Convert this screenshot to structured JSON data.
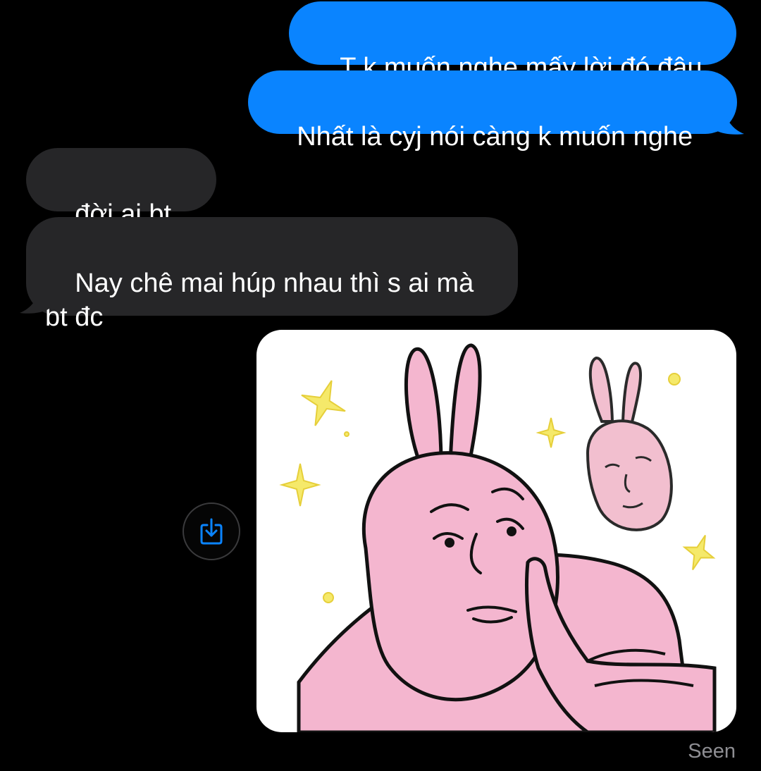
{
  "conversation": {
    "messages": [
      {
        "direction": "sent",
        "text": "T k muốn nghe mấy lời đó đâu"
      },
      {
        "direction": "sent",
        "text": "Nhất là cyj nói càng k muốn nghe"
      },
      {
        "direction": "received",
        "text": "đời ai bt trc"
      },
      {
        "direction": "received",
        "text": "Nay chê mai húp nhau thì s ai mà\nbt đc"
      }
    ],
    "attachment": {
      "type": "sticker-image",
      "description_icon": "pink-rabbit-sticker"
    },
    "save_button_icon": "save-to-device-icon",
    "status": "Seen"
  },
  "colors": {
    "background": "#000000",
    "sent_bubble": "#0a84ff",
    "received_bubble": "#262628",
    "status_text": "#8e8e93",
    "save_icon": "#0a84ff"
  }
}
